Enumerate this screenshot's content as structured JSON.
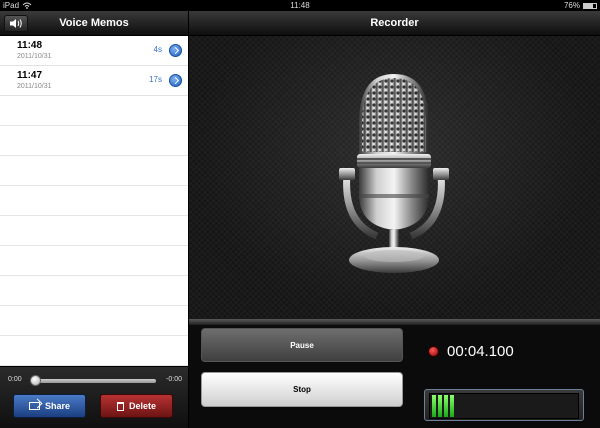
{
  "status_bar": {
    "device": "iPad",
    "time": "11:48",
    "battery": "76%",
    "battery_fraction": 0.76
  },
  "sidebar": {
    "title": "Voice Memos",
    "memos": [
      {
        "time": "11:48",
        "date": "2011/10/31",
        "duration": "4s"
      },
      {
        "time": "11:47",
        "date": "2011/10/31",
        "duration": "17s"
      }
    ],
    "scrubber": {
      "start_label": "0:00",
      "end_label": "-0:00",
      "position": 0
    },
    "share_label": "Share",
    "delete_label": "Delete"
  },
  "recorder": {
    "title": "Recorder",
    "pause_label": "Pause",
    "stop_label": "Stop",
    "elapsed": "00:04.100",
    "level_bars": 4
  },
  "colors": {
    "record_red": "#d01010",
    "meter_green": "#4fd83a",
    "link_blue": "#3a73c6"
  },
  "icons": [
    "speaker-icon",
    "wifi-icon",
    "battery-icon",
    "disclosure-icon",
    "share-icon",
    "trash-icon",
    "microphone-icon",
    "record-indicator-icon"
  ]
}
